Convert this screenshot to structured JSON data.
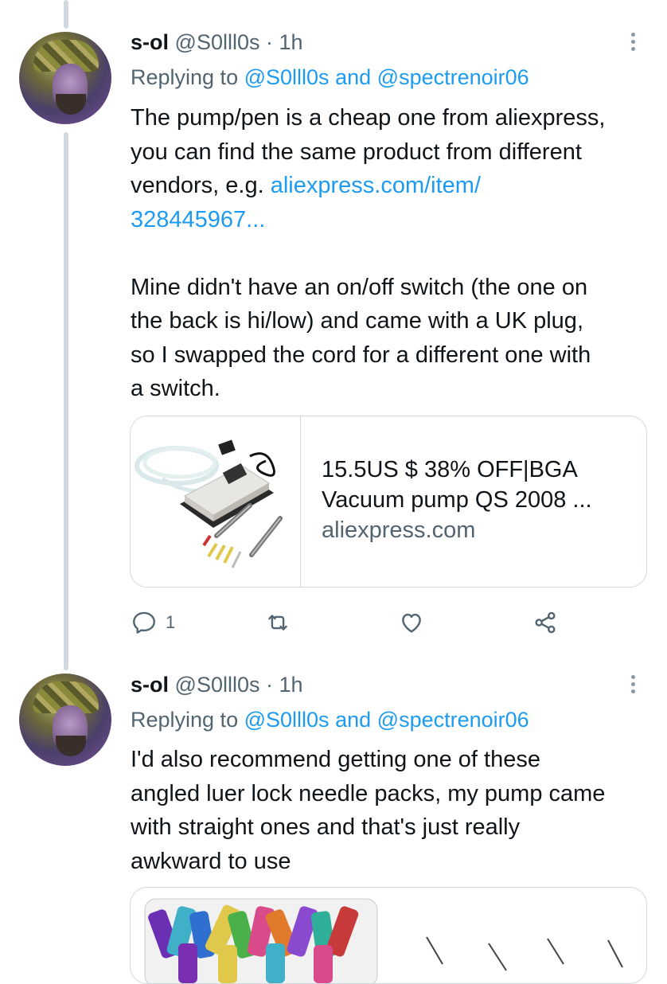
{
  "tweets": [
    {
      "author_name": "s-ol",
      "author_handle": "@S0lll0s",
      "time": "· 1h",
      "replying_prefix": "Replying to",
      "replying_to_1": "@S0lll0s",
      "replying_and": "and",
      "replying_to_2": "@spectrenoir06",
      "body_line1": "The pump/pen is a cheap one from aliexpress,",
      "body_line2": "you can find the same product from different",
      "body_line3_prefix": "vendors, e.g. ",
      "body_link_1": "aliexpress.com/item/",
      "body_link_2": "328445967...",
      "body_para2_line1": "Mine didn't have an on/off switch (the one on",
      "body_para2_line2": "the back is hi/low) and came with a UK plug,",
      "body_para2_line3": "so I swapped the cord for a different one with",
      "body_para2_line4": "a switch.",
      "card": {
        "title_line1": "15.5US $ 38% OFF|BGA",
        "title_line2": "Vacuum pump QS 2008 ...",
        "domain": "aliexpress.com"
      },
      "reply_count": "1",
      "icons": [
        "reply-icon",
        "retweet-icon",
        "like-icon",
        "share-icon"
      ]
    },
    {
      "author_name": "s-ol",
      "author_handle": "@S0lll0s",
      "time": "· 1h",
      "replying_prefix": "Replying to",
      "replying_to_1": "@S0lll0s",
      "replying_and": "and",
      "replying_to_2": "@spectrenoir06",
      "body_line1": "I'd also recommend getting one of these",
      "body_line2": "angled luer lock needle packs, my pump came",
      "body_line3": "with straight ones and that's just really",
      "body_line4": "awkward to use"
    }
  ],
  "colors": {
    "link": "#1d9bf0",
    "secondary_text": "#536471",
    "border": "#cfd9de",
    "thread_line": "#cfd9de"
  }
}
